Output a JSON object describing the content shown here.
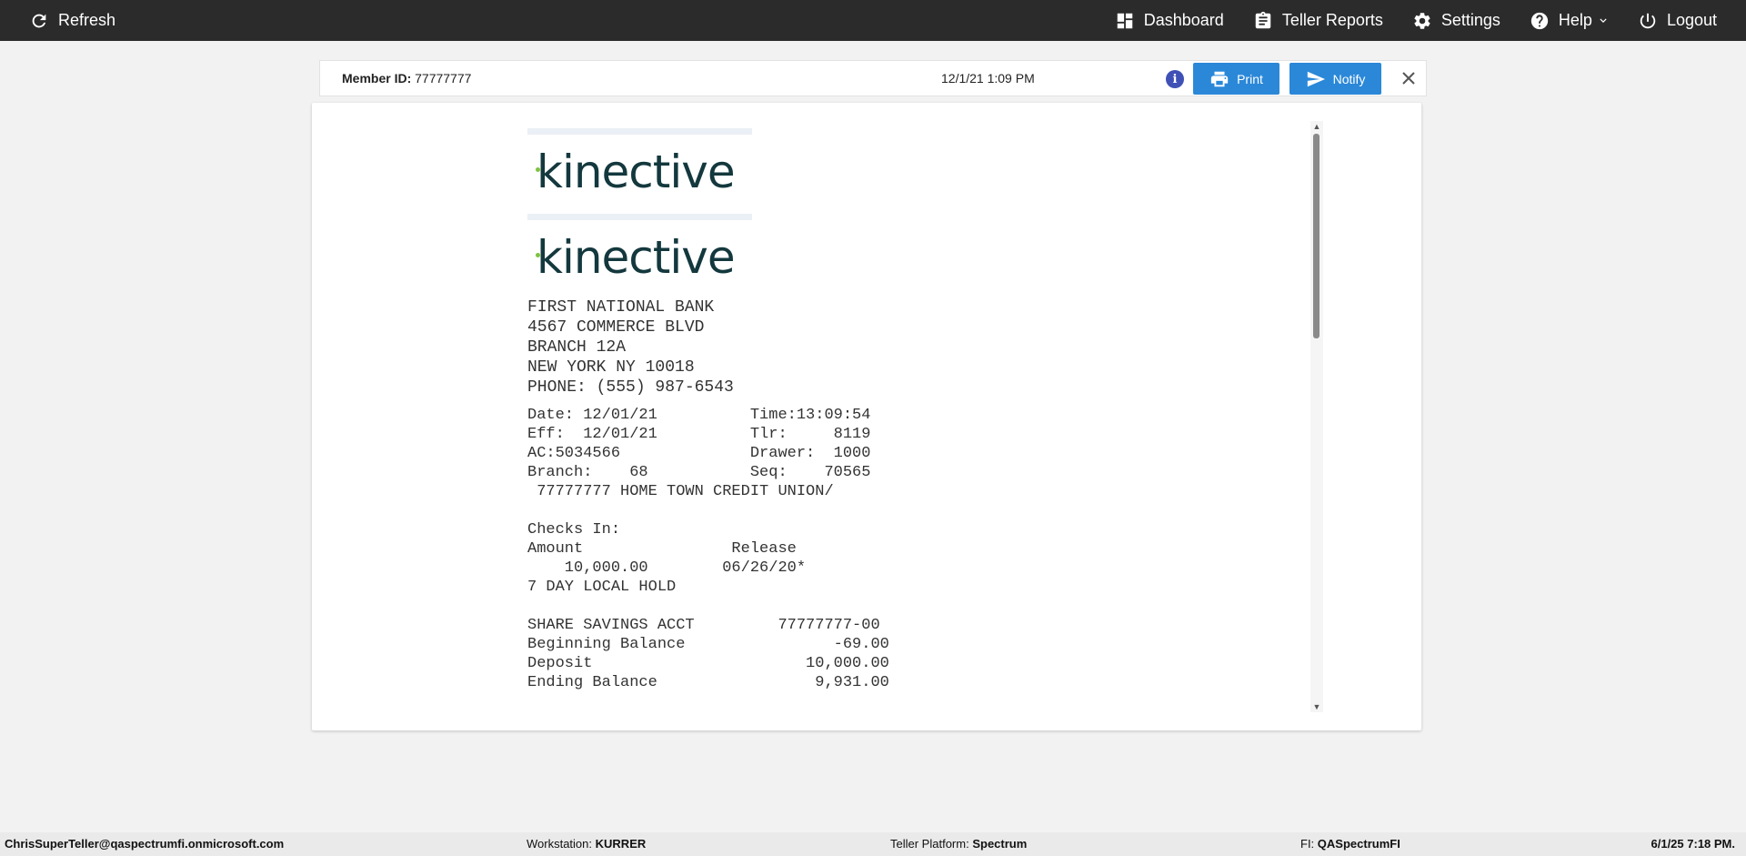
{
  "topbar": {
    "refresh_label": "Refresh",
    "dashboard_label": "Dashboard",
    "teller_reports_label": "Teller Reports",
    "settings_label": "Settings",
    "help_label": "Help",
    "logout_label": "Logout"
  },
  "member_bar": {
    "member_id_label": "Member ID:",
    "member_id_value": "77777777",
    "datetime": "12/1/21 1:09 PM",
    "print_label": "Print",
    "notify_label": "Notify",
    "info_glyph": "i"
  },
  "receipt": {
    "logo_text": "kinective",
    "address": "FIRST NATIONAL BANK\n4567 COMMERCE BLVD\nBRANCH 12A\nNEW YORK NY 10018\nPHONE: (555) 987-6543",
    "body": "Date: 12/01/21          Time:13:09:54\nEff:  12/01/21          Tlr:     8119\nAC:5034566              Drawer:  1000\nBranch:    68           Seq:    70565\n 77777777 HOME TOWN CREDIT UNION/\n\nChecks In:\nAmount                Release\n    10,000.00        06/26/20*\n7 DAY LOCAL HOLD\n\nSHARE SAVINGS ACCT         77777777-00\nBeginning Balance                -69.00\nDeposit                       10,000.00\nEnding Balance                 9,931.00"
  },
  "statusbar": {
    "user": "ChrisSuperTeller@qaspectrumfi.onmicrosoft.com",
    "workstation_label": "Workstation:",
    "workstation_value": "KURRER",
    "platform_label": "Teller Platform:",
    "platform_value": "Spectrum",
    "fi_label": "FI:",
    "fi_value": "QASpectrumFI",
    "datetime": "6/1/25 7:18 PM."
  },
  "colors": {
    "topbar_bg": "#2b2b2b",
    "button_blue": "#2b88d8",
    "info_icon": "#3f51b5",
    "logo_dark": "#13383d",
    "logo_accent": "#7ec242"
  }
}
